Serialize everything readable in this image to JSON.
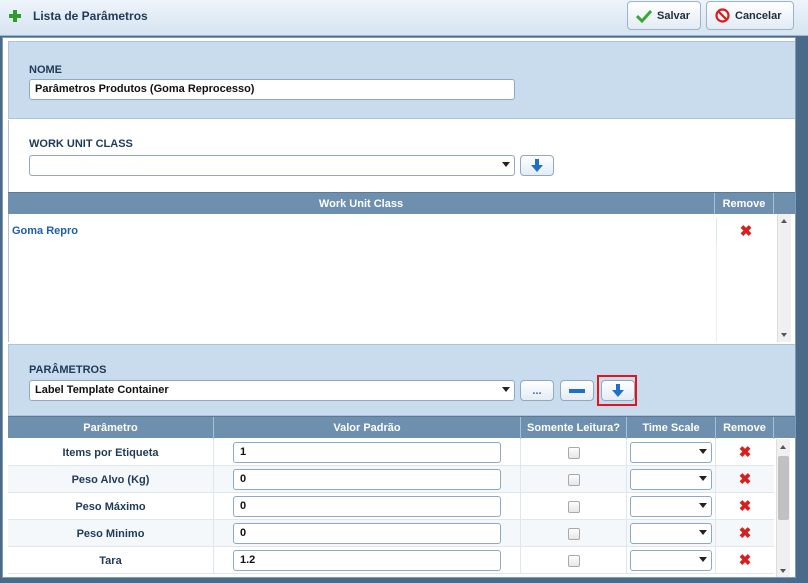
{
  "window": {
    "title": "Lista de Parâmetros"
  },
  "toolbar": {
    "save_label": "Salvar",
    "cancel_label": "Cancelar"
  },
  "nome": {
    "label": "NOME",
    "value": "Parâmetros Produtos (Goma Reprocesso)"
  },
  "work_unit_class": {
    "label": "WORK UNIT CLASS",
    "selected": "",
    "table": {
      "columns": [
        "Work Unit Class",
        "Remove"
      ],
      "rows": [
        {
          "name": "Goma Repro"
        }
      ]
    }
  },
  "parametros": {
    "label": "PARÂMETROS",
    "selected": "Label Template Container",
    "browse_label": "...",
    "table": {
      "columns": [
        "Parâmetro",
        "Valor Padrão",
        "Somente Leitura?",
        "Time Scale",
        "Remove"
      ],
      "rows": [
        {
          "name": "Items por Etiqueta",
          "value": "1",
          "readonly": false,
          "time_scale": ""
        },
        {
          "name": "Peso Alvo (Kg)",
          "value": "0",
          "readonly": false,
          "time_scale": ""
        },
        {
          "name": "Peso Máximo",
          "value": "0",
          "readonly": false,
          "time_scale": ""
        },
        {
          "name": "Peso Minimo",
          "value": "0",
          "readonly": false,
          "time_scale": ""
        },
        {
          "name": "Tara",
          "value": "1.2",
          "readonly": false,
          "time_scale": ""
        }
      ]
    }
  },
  "colors": {
    "header_bg": "#6e8fae",
    "section_bg": "#c9dcee",
    "remove_red": "#d61f1f",
    "highlight_red": "#e2141c",
    "accent_blue": "#1d6fc9"
  },
  "icons": {
    "title": "plus-icon",
    "save": "check-icon",
    "cancel": "prohibited-icon",
    "add": "arrow-down-icon",
    "remove": "x-icon",
    "minus": "minus-icon"
  }
}
